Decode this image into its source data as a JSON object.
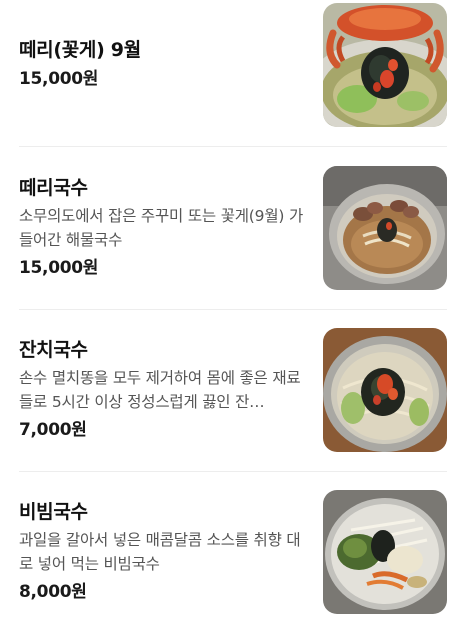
{
  "menu": {
    "items": [
      {
        "name": "떼리(꽃게) 9월",
        "description": "",
        "price": "15,000원",
        "photo": "crab-noodle-soup-photo"
      },
      {
        "name": "떼리국수",
        "description": "소무의도에서 잡은 주꾸미 또는 꽃게(9월) 가 들어간 해물국수",
        "price": "15,000원",
        "photo": "seafood-noodle-photo"
      },
      {
        "name": "잔치국수",
        "description": "손수 멸치똥을 모두 제거하여 몸에 좋은 재료들로 5시간 이상 정성스럽게 끓인 잔…",
        "price": "7,000원",
        "photo": "banquet-noodle-photo"
      },
      {
        "name": "비빔국수",
        "description": "과일을 갈아서 넣은 매콤달콤 소스를 취향 대로 넣어 먹는 비빔국수",
        "price": "8,000원",
        "photo": "spicy-mixed-noodle-photo"
      }
    ]
  },
  "colors": {
    "text": "#111111",
    "description": "#555555",
    "divider": "#ededed"
  }
}
